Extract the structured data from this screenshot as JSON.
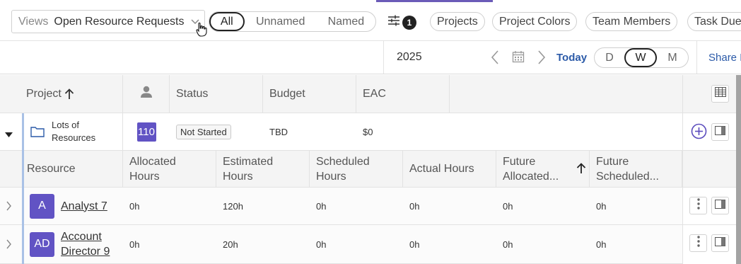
{
  "views": {
    "label": "Views",
    "value": "Open Resource Requests"
  },
  "scope_tabs": [
    {
      "label": "All",
      "active": true
    },
    {
      "label": "Unnamed",
      "active": false
    },
    {
      "label": "Named",
      "active": false
    }
  ],
  "filters": {
    "count": "1"
  },
  "pills": [
    "Projects",
    "Project Colors",
    "Team Members",
    "Task Due"
  ],
  "calendar": {
    "year": "2025",
    "today_label": "Today",
    "scale": [
      {
        "label": "D",
        "active": false
      },
      {
        "label": "W",
        "active": true
      },
      {
        "label": "M",
        "active": false
      }
    ],
    "share_label": "Share F"
  },
  "project_header": {
    "project": "Project",
    "status": "Status",
    "budget": "Budget",
    "eac": "EAC"
  },
  "project": {
    "name_line1": "Lots of",
    "name_line2": "Resources",
    "resource_count": "110",
    "status": "Not Started",
    "budget": "TBD",
    "eac": "$0"
  },
  "resource_header": {
    "resource": "Resource",
    "allocated_1": "Allocated",
    "allocated_2": "Hours",
    "estimated_1": "Estimated",
    "estimated_2": "Hours",
    "scheduled_1": "Scheduled",
    "scheduled_2": "Hours",
    "actual": "Actual Hours",
    "future_alloc_1": "Future",
    "future_alloc_2": "Allocated...",
    "future_sched_1": "Future",
    "future_sched_2": "Scheduled..."
  },
  "resources": [
    {
      "initials": "A",
      "name_line1": "Analyst 7",
      "name_line2": "",
      "allocated": "0h",
      "estimated": "120h",
      "scheduled": "0h",
      "actual": "0h",
      "future_allocated": "0h",
      "future_scheduled": "0h"
    },
    {
      "initials": "AD",
      "name_line1": "Account",
      "name_line2": "Director 9",
      "allocated": "0h",
      "estimated": "20h",
      "scheduled": "0h",
      "actual": "0h",
      "future_allocated": "0h",
      "future_scheduled": "0h"
    }
  ],
  "colors": {
    "accent": "#6b5bb8",
    "avatar": "#6153c4",
    "link_blue": "#2b5aa8",
    "row_marker": "#a9c1e6"
  }
}
